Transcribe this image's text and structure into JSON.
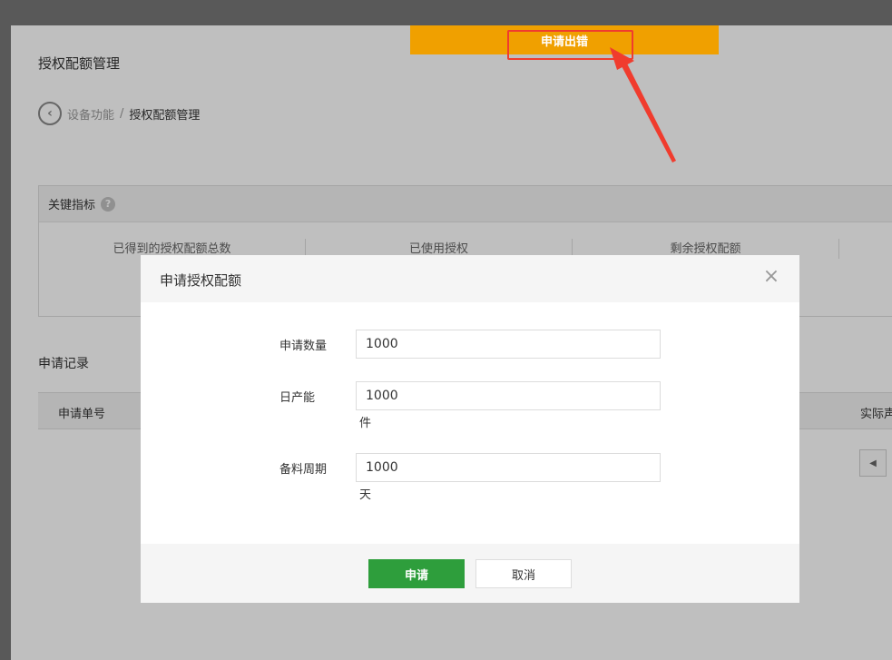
{
  "page": {
    "title": "授权配额管理",
    "breadcrumb_parent": "设备功能",
    "breadcrumb_separator": "/",
    "breadcrumb_current": "授权配额管理"
  },
  "kpi": {
    "header": "关键指标",
    "help_icon": "?",
    "items": [
      "已得到的授权配额总数",
      "已使用授权",
      "剩余授权配额"
    ]
  },
  "records": {
    "title": "申请记录",
    "columns": [
      "申请单号",
      "实际声"
    ]
  },
  "toast": {
    "message": "申请出错",
    "color": "#f0a000",
    "highlight_color": "#f03c2e"
  },
  "modal": {
    "title": "申请授权配额",
    "close_icon": "×",
    "fields": [
      {
        "label": "申请数量",
        "value": "1000",
        "unit": ""
      },
      {
        "label": "日产能",
        "value": "1000",
        "unit": "件"
      },
      {
        "label": "备料周期",
        "value": "1000",
        "unit": "天"
      }
    ],
    "apply_label": "申请",
    "cancel_label": "取消",
    "apply_color": "#2e9e3c"
  }
}
